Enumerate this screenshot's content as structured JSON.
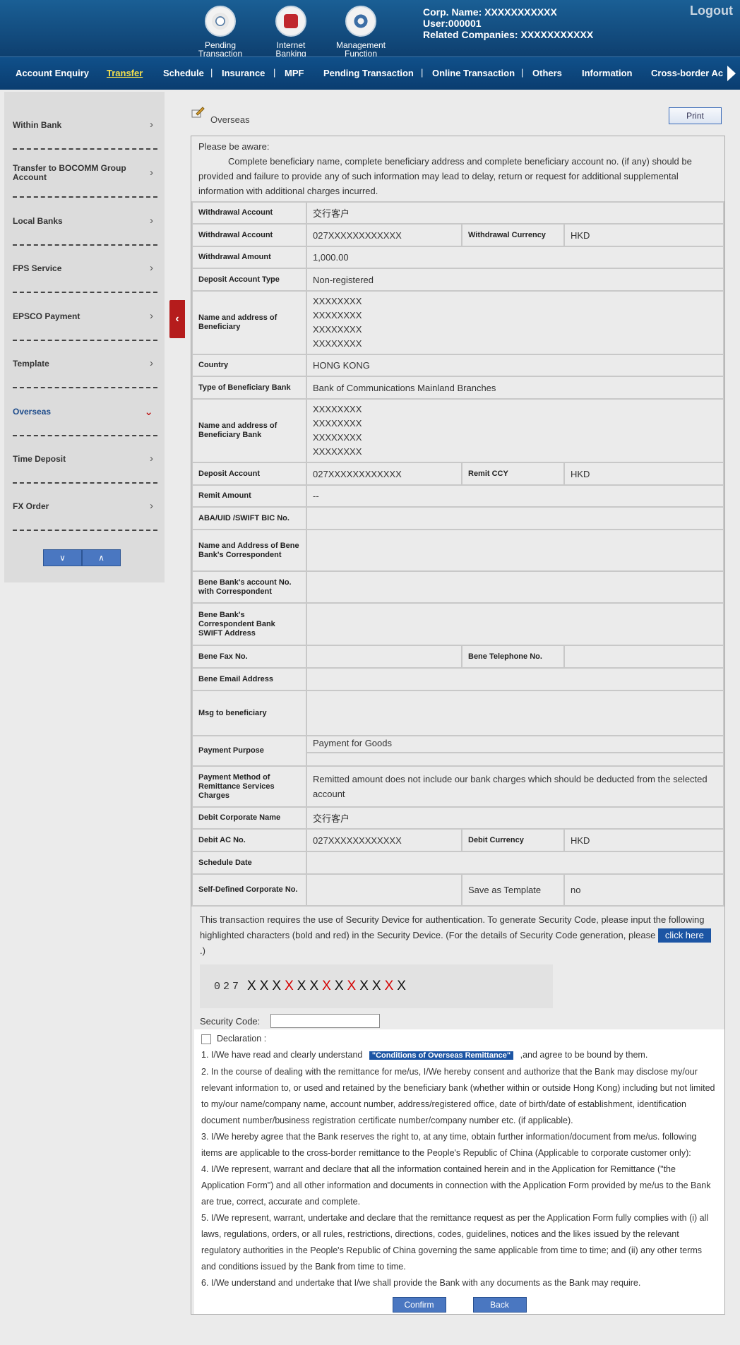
{
  "header": {
    "icons": [
      {
        "label_line1": "Pending",
        "label_line2": "Transaction",
        "icon": "hourglass-icon"
      },
      {
        "label_line1": "Internet",
        "label_line2": "Banking",
        "icon": "internet-banking-icon"
      },
      {
        "label_line1": "Management",
        "label_line2": "Function",
        "icon": "gear-icon"
      }
    ],
    "corp_name": "Corp. Name: XXXXXXXXXXX",
    "user": "User:000001",
    "related": "Related Companies: XXXXXXXXXXX",
    "logout": "Logout"
  },
  "nav": {
    "items": [
      "Account Enquiry",
      "Transfer",
      "Schedule",
      "Insurance",
      "MPF",
      "Pending Transaction",
      "Online Transaction",
      "Others",
      "Information",
      "Cross-border Ac"
    ],
    "active": "Transfer"
  },
  "sidebar": {
    "items": [
      "Within Bank",
      "Transfer to BOCOMM Group Account",
      "Local Banks",
      "FPS Service",
      "EPSCO Payment",
      "Template",
      "Overseas",
      "Time Deposit",
      "FX Order"
    ],
    "active": "Overseas"
  },
  "main": {
    "title": "Overseas",
    "print": "Print",
    "notice_head": "Please be aware:",
    "notice_body": "Complete beneficiary name, complete beneficiary address and complete beneficiary account no. (if any) should be provided and failure to provide any of such information may lead to delay, return or request for additional supplemental information with additional charges incurred.",
    "form": {
      "withdrawal_account_name_label": "Withdrawal Account",
      "withdrawal_account_name": "交行客户",
      "withdrawal_account_label": "Withdrawal Account",
      "withdrawal_account": "027XXXXXXXXXXXX",
      "withdrawal_currency_label": "Withdrawal Currency",
      "withdrawal_currency": "HKD",
      "withdrawal_amount_label": "Withdrawal Amount",
      "withdrawal_amount": "1,000.00",
      "deposit_account_type_label": "Deposit Account Type",
      "deposit_account_type": "Non-registered",
      "beneficiary_name_label": "Name and address of Beneficiary",
      "beneficiary_lines": [
        "XXXXXXXX",
        "XXXXXXXX",
        "XXXXXXXX",
        "XXXXXXXX"
      ],
      "country_label": "Country",
      "country": "HONG KONG",
      "bank_type_label": "Type of Beneficiary Bank",
      "bank_type": "Bank of Communications Mainland Branches",
      "bank_name_label": "Name and address of Beneficiary Bank",
      "bank_lines": [
        "XXXXXXXX",
        "XXXXXXXX",
        "XXXXXXXX",
        "XXXXXXXX"
      ],
      "deposit_account_label": "Deposit Account",
      "deposit_account": "027XXXXXXXXXXXX",
      "remit_ccy_label": "Remit CCY",
      "remit_ccy": "HKD",
      "remit_amount_label": "Remit Amount",
      "remit_amount": "--",
      "aba_label": "ABA/UID /SWIFT BIC No.",
      "correspondent_label": "Name and Address of Bene Bank's Correspondent",
      "bene_account_corr_label": "Bene Bank's account No. with Correspondent",
      "corr_swift_label": "Bene Bank's Correspondent Bank SWIFT Address",
      "fax_label": "Bene Fax No.",
      "tel_label": "Bene Telephone No.",
      "email_label": "Bene Email Address",
      "msg_label": "Msg to beneficiary",
      "purpose_label": "Payment Purpose",
      "purpose": "Payment for Goods",
      "charges_label": "Payment Method of Remittance Services Charges",
      "charges": "Remitted amount does not include our bank charges which should be deducted from the selected account",
      "debit_name_label": "Debit Corporate Name",
      "debit_name": "交行客户",
      "debit_ac_label": "Debit AC No.",
      "debit_ac": "027XXXXXXXXXXXX",
      "debit_currency_label": "Debit Currency",
      "debit_currency": "HKD",
      "schedule_label": "Schedule Date",
      "self_defined_label": "Self-Defined Corporate No.",
      "save_template_label": "Save as Template",
      "save_template": "no"
    },
    "security": {
      "text_before": "This transaction requires the use of Security Device for authentication. To generate Security Code, please input the following highlighted characters (bold and red) in the Security Device. (For the details of Security Code generation, please",
      "click_here": "click here",
      "text_after": ".)",
      "code_prefix": "027",
      "code_chars": [
        {
          "c": "X",
          "red": false
        },
        {
          "c": "X",
          "red": false
        },
        {
          "c": "X",
          "red": false
        },
        {
          "c": "X",
          "red": true
        },
        {
          "c": "X",
          "red": false
        },
        {
          "c": "X",
          "red": false
        },
        {
          "c": "X",
          "red": true
        },
        {
          "c": "X",
          "red": false
        },
        {
          "c": "X",
          "red": true
        },
        {
          "c": "X",
          "red": false
        },
        {
          "c": "X",
          "red": false
        },
        {
          "c": "X",
          "red": true
        },
        {
          "c": "X",
          "red": false
        }
      ],
      "code_label": "Security Code:"
    },
    "declaration": {
      "title": "Declaration :",
      "item1_before": "1. I/We have read and clearly understand",
      "item1_link": "\"Conditions of Overseas Remittance\"",
      "item1_after": ",and agree to be bound by them.",
      "item2": "2. In the course of dealing with the remittance for me/us, I/We hereby consent and authorize that the Bank may disclose my/our relevant information to, or used and retained by the beneficiary bank (whether within or outside Hong Kong) including but not limited to my/our name/company name, account number, address/registered office, date of birth/date of establishment, identification document number/business registration certificate number/company number etc. (if applicable).",
      "item3": "3. I/We hereby agree that the Bank reserves the right to, at any time, obtain further information/document from me/us. following items are applicable to the cross-border remittance to the People's Republic of China (Applicable to corporate customer only):",
      "item4": "4. I/We represent, warrant and declare that all the information contained herein and in the Application for Remittance (\"the Application Form\") and all other information and documents in connection with the Application Form provided by me/us to the Bank are true, correct, accurate and complete.",
      "item5": "5. I/We represent, warrant, undertake and declare that the remittance request as per the Application Form fully complies with (i) all laws, regulations, orders, or all rules, restrictions, directions, codes, guidelines, notices and the likes issued by the relevant regulatory authorities in the People's Republic of China governing the same applicable from time to time; and (ii) any other terms and conditions issued by the Bank from time to time.",
      "item6": "6. I/We understand and undertake that I/we shall provide the Bank with any documents as the Bank may require."
    },
    "confirm": "Confirm",
    "back": "Back"
  },
  "colors": {
    "header_bg": "#0e3f6f",
    "nav_active": "#f4e04d",
    "collapse_tab": "#b51c1c",
    "button_blue": "#4a77c1"
  }
}
